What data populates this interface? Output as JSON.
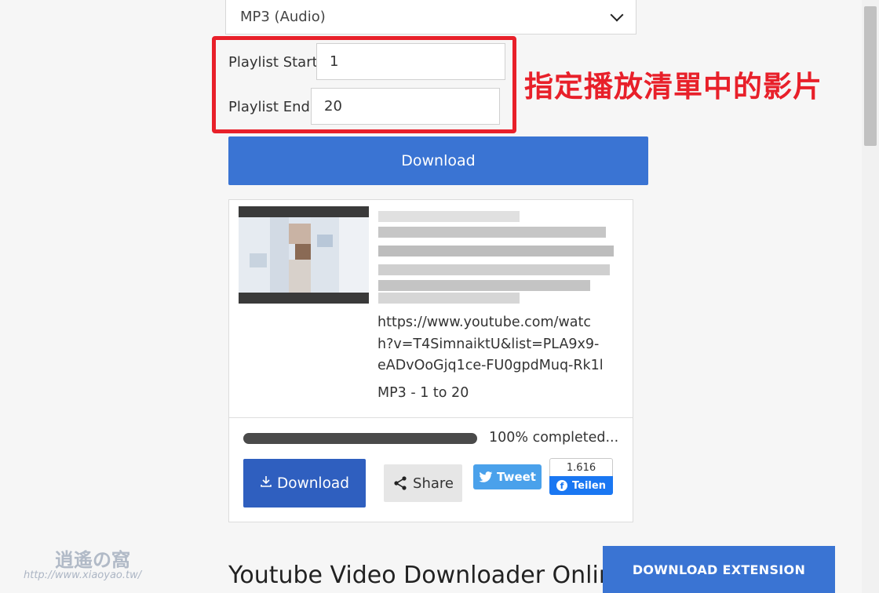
{
  "form": {
    "format_select_value": "MP3 (Audio)",
    "playlist_start_label": "Playlist Start",
    "playlist_start_value": "1",
    "playlist_end_label": "Playlist End",
    "playlist_end_value": "20",
    "annotation": "指定播放清單中的影片",
    "download_label": "Download"
  },
  "result": {
    "url": "https://www.youtube.com/watch?v=T4SimnaiktU&list=PLA9x9-eADvOoGjq1ce-FU0gpdMuq-Rk1l",
    "format_info": "MP3 - 1 to 20",
    "progress_text": "100% completed...",
    "progress_value": 1.0,
    "download_label": "Download",
    "share_label": "Share",
    "tweet_label": "Tweet",
    "fb_count": "1.616",
    "fb_label": "Teilen"
  },
  "page": {
    "section_heading": "Youtube Video Downloader Online",
    "extension_button": "DOWNLOAD EXTENSION"
  },
  "watermark": {
    "logo": "逍遙の窩",
    "url": "http://www.xiaoyao.tw/"
  },
  "colors": {
    "accent": "#3a74d3",
    "highlight": "#e8202a",
    "twitter": "#4aa1eb",
    "facebook": "#1a77f2"
  },
  "icons": {
    "select": "chevron-down-icon",
    "download": "download-icon",
    "share": "share-icon",
    "tweet": "twitter-bird-icon",
    "facebook": "facebook-icon"
  }
}
